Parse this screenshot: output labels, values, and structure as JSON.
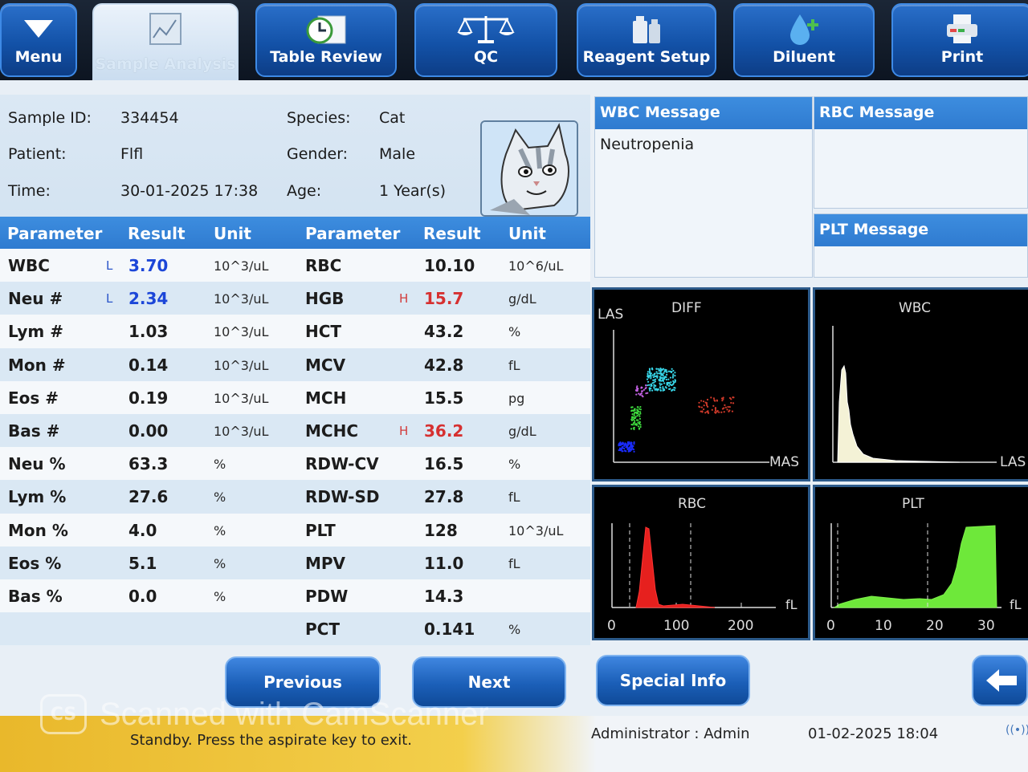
{
  "toolbar": {
    "menu": "Menu",
    "sample_analysis": "Sample Analysis",
    "table_review": "Table Review",
    "qc": "QC",
    "reagent_setup": "Reagent Setup",
    "diluent": "Diluent",
    "print": "Print"
  },
  "sample": {
    "id_label": "Sample ID:",
    "id_value": "334454",
    "patient_label": "Patient:",
    "patient_value": "Flfl",
    "time_label": "Time:",
    "time_value": "30-01-2025 17:38",
    "species_label": "Species:",
    "species_value": "Cat",
    "gender_label": "Gender:",
    "gender_value": "Male",
    "age_label": "Age:",
    "age_value": "1 Year(s)"
  },
  "table": {
    "headers": [
      "Parameter",
      "Result",
      "Unit",
      "Parameter",
      "Result",
      "Unit"
    ],
    "rows": [
      {
        "p1": "WBC",
        "f1": "L",
        "r1": "3.70",
        "u1": "10^3/uL",
        "p2": "RBC",
        "f2": "",
        "r2": "10.10",
        "u2": "10^6/uL"
      },
      {
        "p1": "Neu #",
        "f1": "L",
        "r1": "2.34",
        "u1": "10^3/uL",
        "p2": "HGB",
        "f2": "H",
        "r2": "15.7",
        "u2": "g/dL"
      },
      {
        "p1": "Lym #",
        "f1": "",
        "r1": "1.03",
        "u1": "10^3/uL",
        "p2": "HCT",
        "f2": "",
        "r2": "43.2",
        "u2": "%"
      },
      {
        "p1": "Mon #",
        "f1": "",
        "r1": "0.14",
        "u1": "10^3/uL",
        "p2": "MCV",
        "f2": "",
        "r2": "42.8",
        "u2": "fL"
      },
      {
        "p1": "Eos #",
        "f1": "",
        "r1": "0.19",
        "u1": "10^3/uL",
        "p2": "MCH",
        "f2": "",
        "r2": "15.5",
        "u2": "pg"
      },
      {
        "p1": "Bas #",
        "f1": "",
        "r1": "0.00",
        "u1": "10^3/uL",
        "p2": "MCHC",
        "f2": "H",
        "r2": "36.2",
        "u2": "g/dL"
      },
      {
        "p1": "Neu %",
        "f1": "",
        "r1": "63.3",
        "u1": "%",
        "p2": "RDW-CV",
        "f2": "",
        "r2": "16.5",
        "u2": "%"
      },
      {
        "p1": "Lym %",
        "f1": "",
        "r1": "27.6",
        "u1": "%",
        "p2": "RDW-SD",
        "f2": "",
        "r2": "27.8",
        "u2": "fL"
      },
      {
        "p1": "Mon %",
        "f1": "",
        "r1": "4.0",
        "u1": "%",
        "p2": "PLT",
        "f2": "",
        "r2": "128",
        "u2": "10^3/uL"
      },
      {
        "p1": "Eos %",
        "f1": "",
        "r1": "5.1",
        "u1": "%",
        "p2": "MPV",
        "f2": "",
        "r2": "11.0",
        "u2": "fL"
      },
      {
        "p1": "Bas %",
        "f1": "",
        "r1": "0.0",
        "u1": "%",
        "p2": "PDW",
        "f2": "",
        "r2": "14.3",
        "u2": ""
      },
      {
        "p1": "",
        "f1": "",
        "r1": "",
        "u1": "",
        "p2": "PCT",
        "f2": "",
        "r2": "0.141",
        "u2": "%"
      }
    ]
  },
  "messages": {
    "wbc_title": "WBC Message",
    "wbc_text": "Neutropenia",
    "rbc_title": "RBC Message",
    "plt_title": "PLT Message"
  },
  "plots": {
    "diff": {
      "title": "DIFF",
      "y_label": "LAS",
      "x_label": "MAS"
    },
    "wbc": {
      "title": "WBC",
      "x_label": "LAS"
    },
    "rbc": {
      "title": "RBC",
      "unit": "fL",
      "ticks": [
        "0",
        "100",
        "200"
      ]
    },
    "plt": {
      "title": "PLT",
      "unit": "fL",
      "ticks": [
        "0",
        "10",
        "20",
        "30"
      ]
    }
  },
  "buttons": {
    "previous": "Previous",
    "next": "Next",
    "special_info": "Special Info"
  },
  "status": {
    "message": "Standby. Press the aspirate key to exit.",
    "user": "Administrator : Admin",
    "datetime": "01-02-2025 18:04"
  },
  "watermark": "Scanned with CamScanner",
  "colors": {
    "accent": "#2f7bd0",
    "flag_high": "#d23c3c",
    "flag_low": "#1c46d8"
  }
}
